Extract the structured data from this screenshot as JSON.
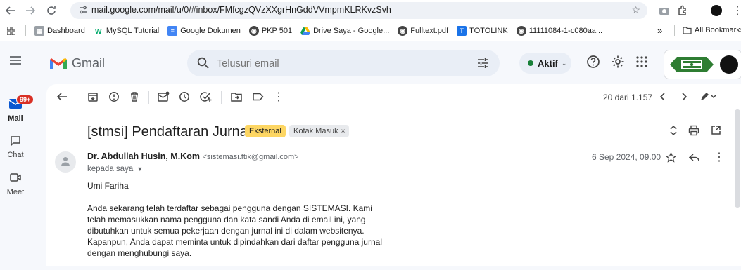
{
  "browser": {
    "url": "mail.google.com/mail/u/0/#inbox/FMfcgzQVzXXgrHnGddVVmpmKLRKvzSvh",
    "bookmarks": [
      {
        "label": "Dashboard",
        "icon": "dashboard-icon",
        "color": "#5f6368"
      },
      {
        "label": "MySQL Tutorial",
        "icon": "w3schools-icon",
        "color": "#04aa6d"
      },
      {
        "label": "Google Dokumen",
        "icon": "docs-icon",
        "color": "#4285f4"
      },
      {
        "label": "PKP 501",
        "icon": "pkp-icon",
        "color": "#1f1f1f"
      },
      {
        "label": "Drive Saya - Google...",
        "icon": "drive-icon",
        "color": "#fbbc04"
      },
      {
        "label": "Fulltext.pdf",
        "icon": "globe-icon",
        "color": "#444"
      },
      {
        "label": "TOTOLINK",
        "icon": "totolink-icon",
        "color": "#1a73e8"
      },
      {
        "label": "11111084-1-c080aa...",
        "icon": "globe-icon",
        "color": "#444"
      }
    ],
    "more_label": "»",
    "all_bookmarks_label": "All Bookmarks"
  },
  "gmail": {
    "logo_text": "Gmail",
    "search_placeholder": "Telusuri email",
    "status_label": "Aktif",
    "status_color": "#188038"
  },
  "rail": {
    "mail_label": "Mail",
    "mail_badge": "99+",
    "chat_label": "Chat",
    "meet_label": "Meet"
  },
  "email": {
    "counter": "20 dari 1.157",
    "subject": "[stmsi] Pendaftaran Jurnal",
    "label_external": "Eksternal",
    "label_inbox": "Kotak Masuk",
    "label_inbox_remove": "×",
    "sender_name": "Dr. Abdullah Husin, M.Kom",
    "sender_email": "<sistemasi.ftik@gmail.com>",
    "to_label": "kepada saya",
    "date": "6 Sep 2024, 09.00",
    "greeting": "Umi Fariha",
    "body": "Anda sekarang telah terdaftar sebagai pengguna dengan SISTEMASI. Kami telah memasukkan nama pengguna dan kata sandi Anda di email ini, yang dibutuhkan untuk semua pekerjaan dengan jurnal ini di dalam websitenya. Kapanpun, Anda dapat meminta untuk dipindahkan dari daftar pengguna jurnal dengan menghubungi saya."
  },
  "colors": {
    "accent_badge": "#d93025",
    "external_chip": "#fdd663"
  }
}
